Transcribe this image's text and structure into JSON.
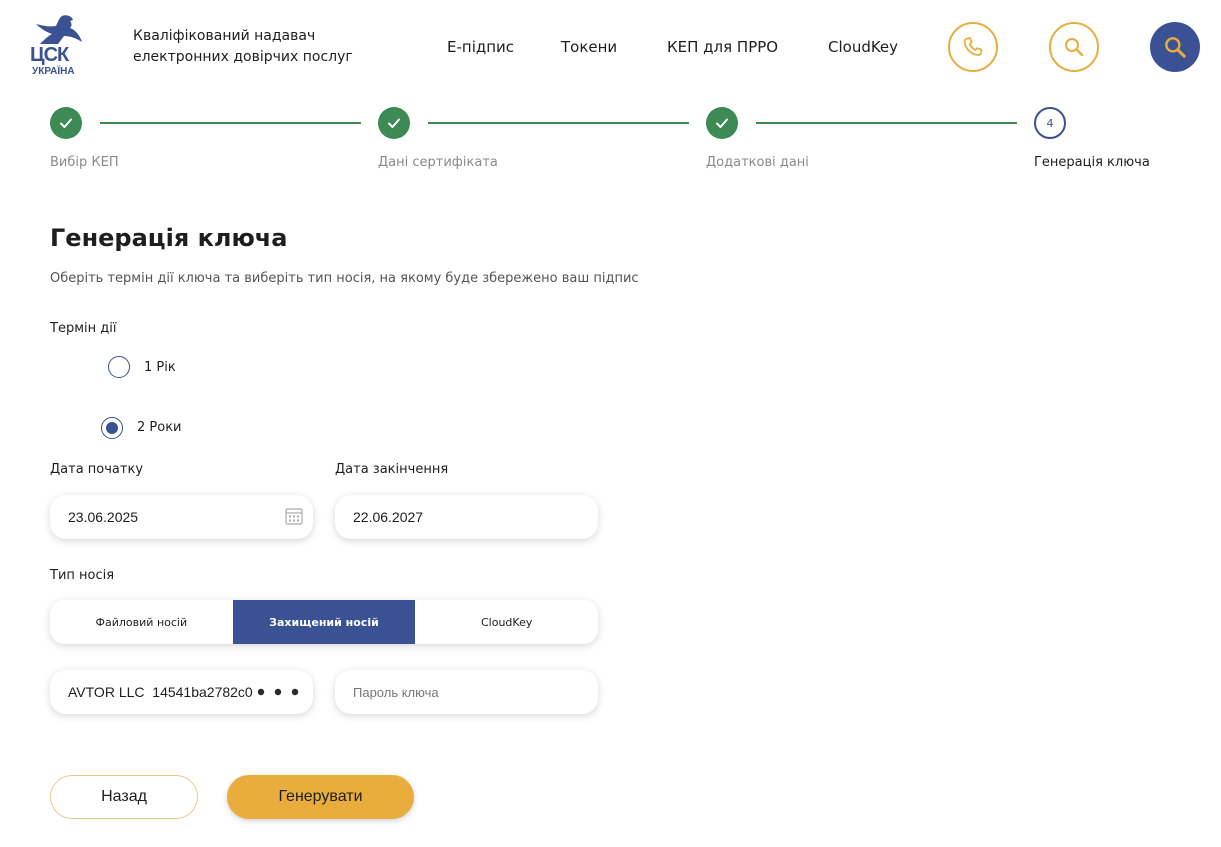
{
  "header": {
    "logo_main": "ЦСК",
    "logo_sub": "УКРАЇНА",
    "tagline": "Кваліфікований надавач електронних довірчих послуг",
    "nav": [
      "Е-підпис",
      "Токени",
      "КЕП для ПРРО",
      "CloudKey"
    ]
  },
  "stepper": {
    "steps": [
      {
        "label": "Вибір КЕП",
        "state": "done"
      },
      {
        "label": "Дані сертифіката",
        "state": "done"
      },
      {
        "label": "Додаткові дані",
        "state": "done"
      },
      {
        "label": "Генерація ключа",
        "state": "current",
        "number": "4"
      }
    ]
  },
  "form": {
    "title": "Генерація ключа",
    "subtitle": "Оберіть термін дії ключа та виберіть тип носія, на якому буде збережено ваш підпис",
    "term_label": "Термін дії",
    "term_options": [
      {
        "label": "1 Рік",
        "checked": false
      },
      {
        "label": "2 Роки",
        "checked": true
      }
    ],
    "start_date_label": "Дата початку",
    "start_date_value": "23.06.2025",
    "end_date_label": "Дата закінчення",
    "end_date_value": "22.06.2027",
    "media_label": "Тип носія",
    "media_options": [
      {
        "label": "Файловий носій",
        "active": false
      },
      {
        "label": "Захищений носій",
        "active": true
      },
      {
        "label": "CloudKey",
        "active": false
      }
    ],
    "device_value": "AVTOR LLC  14541ba2782c0",
    "password_placeholder": "Пароль ключа",
    "back_label": "Назад",
    "generate_label": "Генерувати"
  },
  "colors": {
    "brand_blue": "#3a5294",
    "accent_gold": "#e8ad3c",
    "success_green": "#3d8a55"
  }
}
